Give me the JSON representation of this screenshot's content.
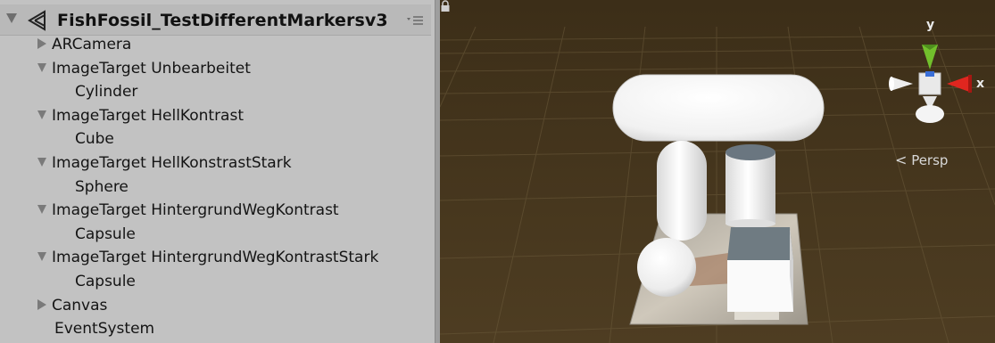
{
  "hierarchy": {
    "scene_title": "FishFossil_TestDifferentMarkersv3",
    "menu_icon": "≡",
    "items": [
      {
        "label": "ARCamera",
        "depth": 0,
        "arrow": "collapsed"
      },
      {
        "label": "ImageTarget Unbearbeitet",
        "depth": 0,
        "arrow": "expanded"
      },
      {
        "label": "Cylinder",
        "depth": 1,
        "arrow": "none"
      },
      {
        "label": "ImageTarget HellKontrast",
        "depth": 0,
        "arrow": "expanded"
      },
      {
        "label": "Cube",
        "depth": 1,
        "arrow": "none"
      },
      {
        "label": "ImageTarget HellKonstrastStark",
        "depth": 0,
        "arrow": "expanded"
      },
      {
        "label": "Sphere",
        "depth": 1,
        "arrow": "none"
      },
      {
        "label": "ImageTarget HintergrundWegKontrast",
        "depth": 0,
        "arrow": "expanded"
      },
      {
        "label": "Capsule",
        "depth": 1,
        "arrow": "none"
      },
      {
        "label": "ImageTarget HintergrundWegKontrastStark",
        "depth": 0,
        "arrow": "expanded"
      },
      {
        "label": "Capsule",
        "depth": 1,
        "arrow": "none"
      },
      {
        "label": "Canvas",
        "depth": 0,
        "arrow": "collapsed"
      },
      {
        "label": "EventSystem",
        "depth": 0,
        "arrow": "none"
      }
    ]
  },
  "scene_view": {
    "projection_label": "Persp",
    "gizmo": {
      "y_label": "y",
      "x_label": "x"
    },
    "colors": {
      "ground": "#47381f",
      "grid": "#6a5a3a",
      "y_axis": "#6fc02a",
      "x_axis": "#e0261f",
      "z_axis": "#3a6fd8"
    }
  }
}
